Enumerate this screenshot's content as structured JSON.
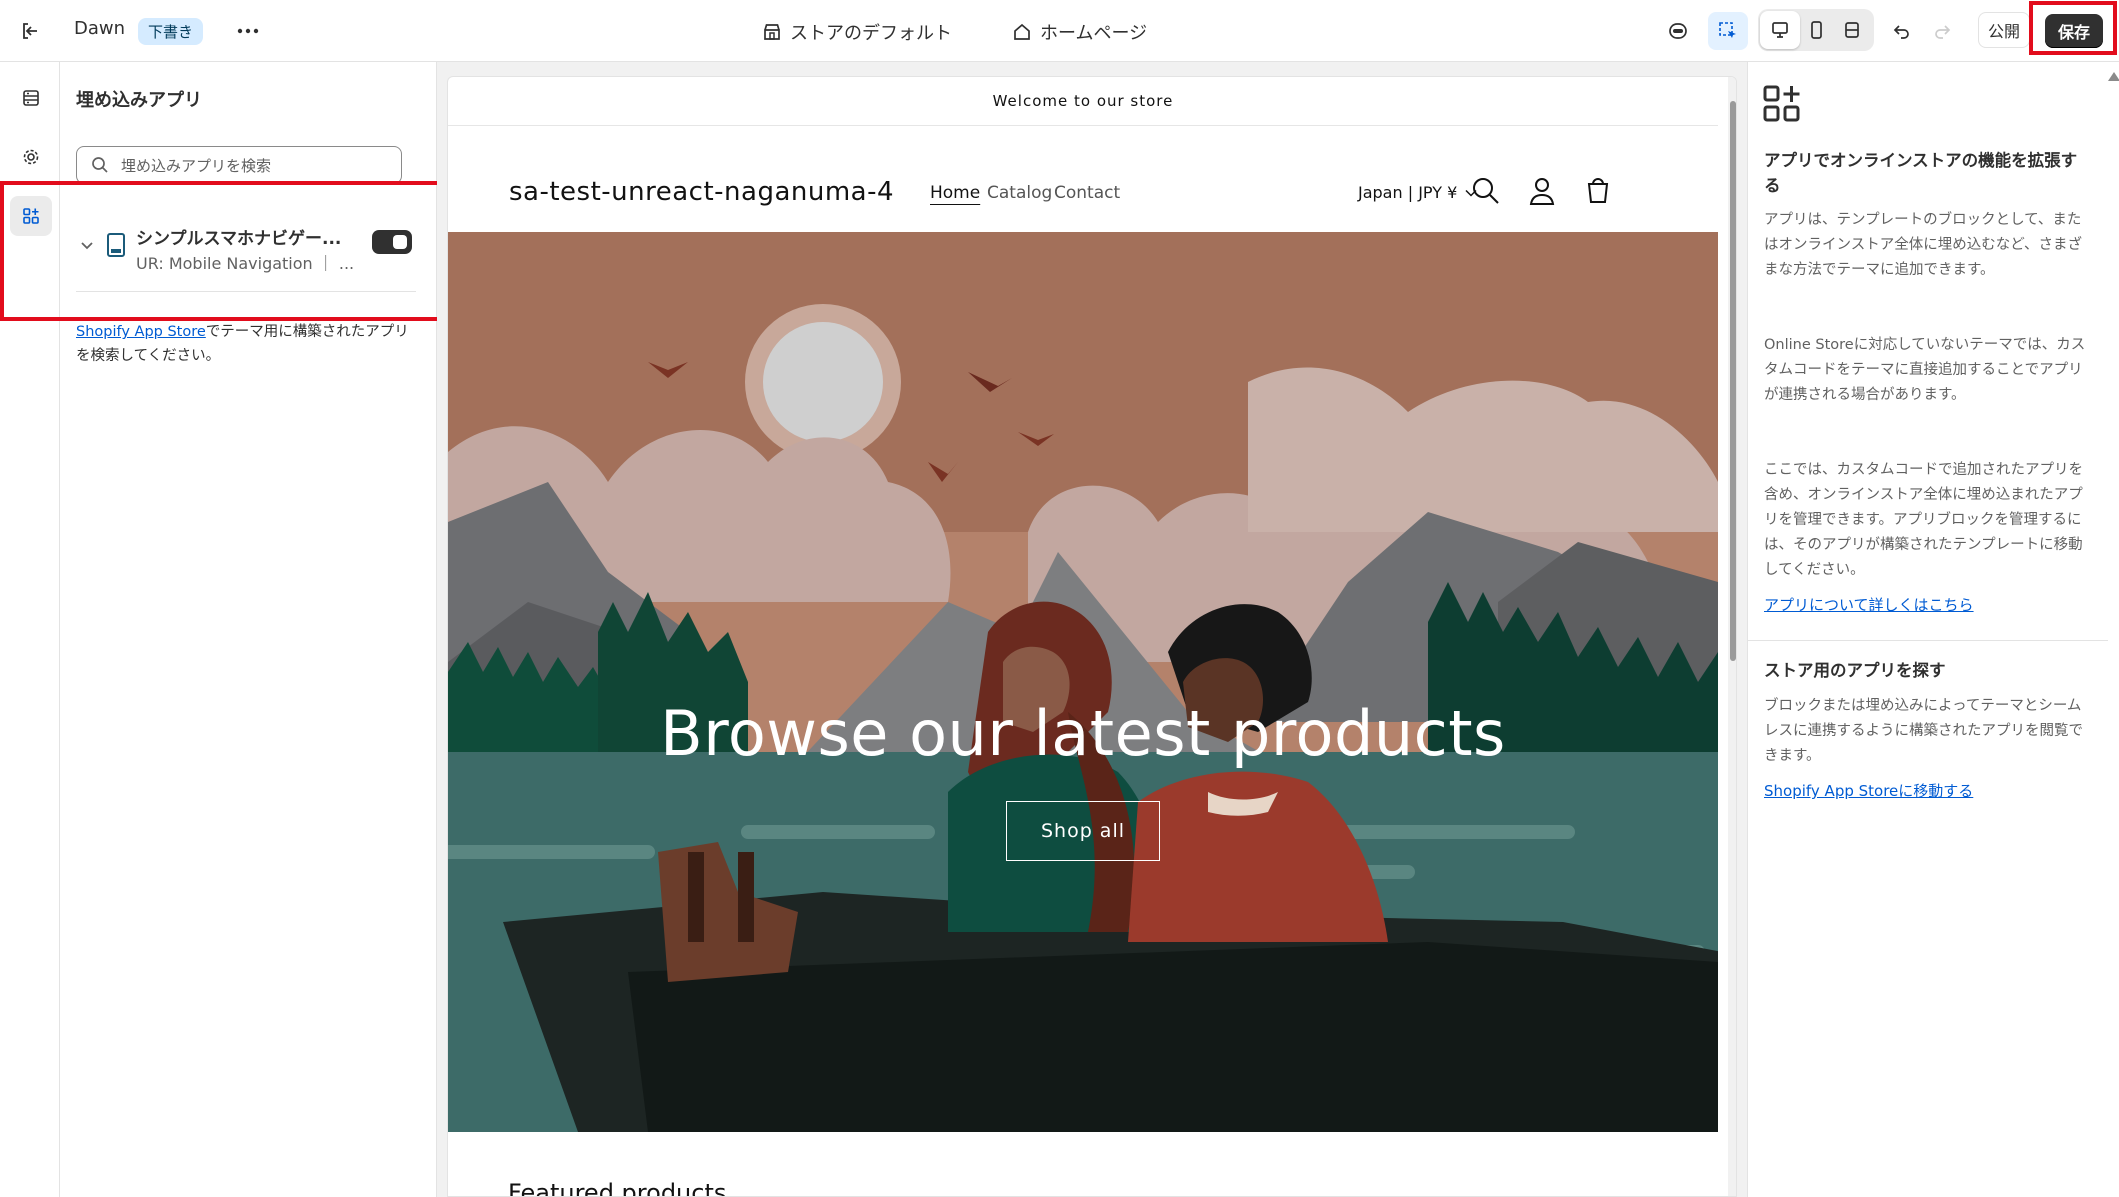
{
  "topbar": {
    "theme_name": "Dawn",
    "draft_badge": "下書き",
    "more_icon": "more-horizontal-icon",
    "context_store": "ストアのデフォルト",
    "context_page": "ホームページ",
    "publish_label": "公開",
    "save_label": "保存"
  },
  "left_panel": {
    "title": "埋め込みアプリ",
    "search_placeholder": "埋め込みアプリを検索",
    "app": {
      "title": "シンプルスマホナビゲー...",
      "subtitle": "UR: Mobile Navigation ｜ ...",
      "enabled": true
    },
    "help_link": "Shopify App Store",
    "help_text": "でテーマ用に構築されたアプリを検索してください。"
  },
  "preview": {
    "announcement": "Welcome to our store",
    "store_name": "sa-test-unreact-naganuma-4",
    "nav": [
      "Home",
      "Catalog",
      "Contact"
    ],
    "locale": "Japan | JPY ¥",
    "hero_title": "Browse our latest products",
    "hero_button": "Shop all",
    "next_section_heading": "Featured products"
  },
  "right_panel": {
    "heading": "アプリでオンラインストアの機能を拡張する",
    "p1": "アプリは、テンプレートのブロックとして、またはオンラインストア全体に埋め込むなど、さまざまな方法でテーマに追加できます。",
    "p2": "Online Storeに対応していないテーマでは、カスタムコードをテーマに直接追加することでアプリが連携される場合があります。",
    "p3": "ここでは、カスタムコードで追加されたアプリを含め、オンラインストア全体に埋め込まれたアプリを管理できます。アプリブロックを管理するには、そのアプリが構築されたテンプレートに移動してください。",
    "learn_link": "アプリについて詳しくはこちら",
    "heading2": "ストア用のアプリを探す",
    "p4": "ブロックまたは埋め込みによってテーマとシームレスに連携するように構築されたアプリを閲覧できます。",
    "store_link": "Shopify App Storeに移動する"
  },
  "colors": {
    "highlight": "#e20c1c",
    "link": "#005bd3",
    "primary_button": "#303030"
  }
}
